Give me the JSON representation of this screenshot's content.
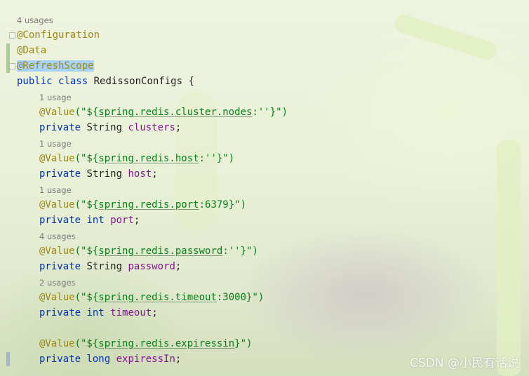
{
  "editor": {
    "class_usages": "4 usages",
    "annotations": {
      "configuration": "@Configuration",
      "data": "@Data",
      "refresh_scope": "@RefreshScope"
    },
    "class_decl": {
      "public": "public",
      "class": "class",
      "name": "RedissonConfigs {"
    },
    "fields": [
      {
        "usages": "1 usage",
        "annotation": "@Value",
        "open": "(\"${",
        "property": "spring.redis.cluster.nodes",
        "default": ":''}",
        "close": "\")",
        "modifier": "private",
        "type": "String",
        "name": "clusters",
        "end": ";"
      },
      {
        "usages": "1 usage",
        "annotation": "@Value",
        "open": "(\"${",
        "property": "spring.redis.host",
        "default": ":''}",
        "close": "\")",
        "modifier": "private",
        "type": "String",
        "name": "host",
        "end": ";"
      },
      {
        "usages": "1 usage",
        "annotation": "@Value",
        "open": "(\"${",
        "property": "spring.redis.port",
        "default": ":6379}",
        "close": "\")",
        "modifier": "private",
        "type": "int",
        "name": "port",
        "end": ";"
      },
      {
        "usages": "4 usages",
        "annotation": "@Value",
        "open": "(\"${",
        "property": "spring.redis.password",
        "default": ":''}",
        "close": "\")",
        "modifier": "private",
        "type": "String",
        "name": "password",
        "end": ";"
      },
      {
        "usages": "2 usages",
        "annotation": "@Value",
        "open": "(\"${",
        "property": "spring.redis.timeout",
        "default": ":3000}",
        "close": "\")",
        "modifier": "private",
        "type": "int",
        "name": "timeout",
        "end": ";"
      },
      {
        "usages": "",
        "annotation": "@Value",
        "open": "(\"${",
        "property": "spring.redis.expiressin",
        "default": "}",
        "close": "\")",
        "modifier": "private",
        "type": "long",
        "name": "expiressIn",
        "end": ";"
      }
    ]
  },
  "watermark": "CSDN @小民有话说",
  "colors": {
    "annotation": "#9e880d",
    "keyword": "#0033b3",
    "field": "#871094",
    "string": "#067d17",
    "selection": "#a6d2ff",
    "gutter_change": "#a7cf95"
  }
}
